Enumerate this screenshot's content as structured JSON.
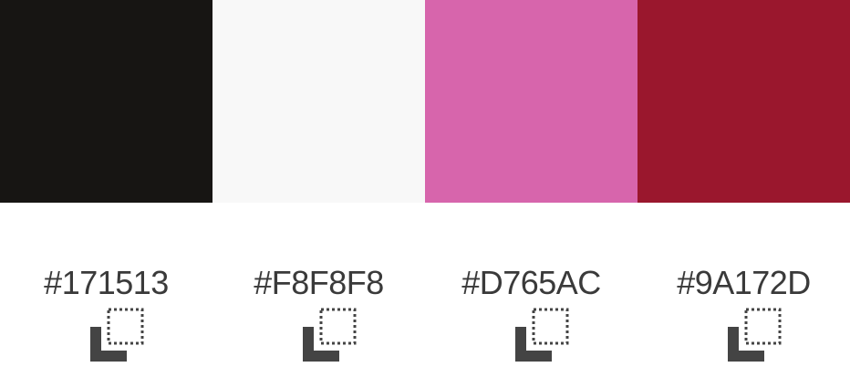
{
  "palette": {
    "colors": [
      {
        "hex": "#171513",
        "swatch": "#171513",
        "copy_icon": "copy-icon"
      },
      {
        "hex": "#F8F8F8",
        "swatch": "#F8F8F8",
        "copy_icon": "copy-icon"
      },
      {
        "hex": "#D765AC",
        "swatch": "#D765AC",
        "copy_icon": "copy-icon"
      },
      {
        "hex": "#9A172D",
        "swatch": "#9A172D",
        "copy_icon": "copy-icon"
      }
    ],
    "text_color": "#3a3a3a",
    "icon_color": "#444444"
  }
}
